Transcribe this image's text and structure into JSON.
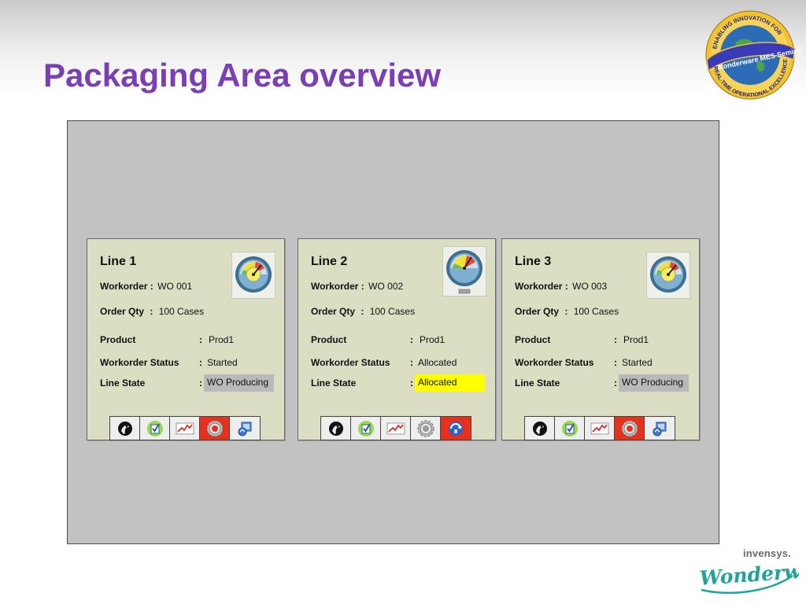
{
  "page": {
    "title": "Packaging Area overview"
  },
  "branding": {
    "seal_top_text": "ENABLING INNOVATION FOR",
    "seal_center_text": "Wonderware MES Seminar",
    "seal_bottom_text": "REAL-TIME OPERATIONAL EXCELLENCE",
    "company": "invensys.",
    "product_logo": "Wonderware"
  },
  "labels": {
    "workorder": "Workorder :",
    "order_qty": "Order Qty",
    "product": "Product",
    "workorder_status": "Workorder Status",
    "line_state": "Line State",
    "colon": ":"
  },
  "lines": [
    {
      "name": "Line 1",
      "workorder": "WO 001",
      "order_qty": "100  Cases",
      "product": "Prod1",
      "workorder_status": "Started",
      "line_state": "WO Producing",
      "line_state_color": "#b9b9b9",
      "gauge_icon": "speed-gauge-icon"
    },
    {
      "name": "Line 2",
      "workorder": "WO 002",
      "order_qty": "100  Cases",
      "product": "Prod1",
      "workorder_status": "Allocated",
      "line_state": "Allocated",
      "line_state_color": "#ffff00",
      "gauge_icon": "speed-gauge-icon"
    },
    {
      "name": "Line 3",
      "workorder": "WO 003",
      "order_qty": "100  Cases",
      "product": "Prod1",
      "workorder_status": "Started",
      "line_state": "WO Producing",
      "line_state_color": "#b9b9b9",
      "gauge_icon": "speed-gauge-icon"
    }
  ],
  "toolbar_icons": [
    "downtime-icon",
    "checklist-icon",
    "trend-chart-icon",
    "gear-icon",
    "production-icon"
  ],
  "colors": {
    "title": "#7a3fb3",
    "panel": "#c2c2c2",
    "card": "#dcdec3",
    "active_button": "#e8301c"
  }
}
